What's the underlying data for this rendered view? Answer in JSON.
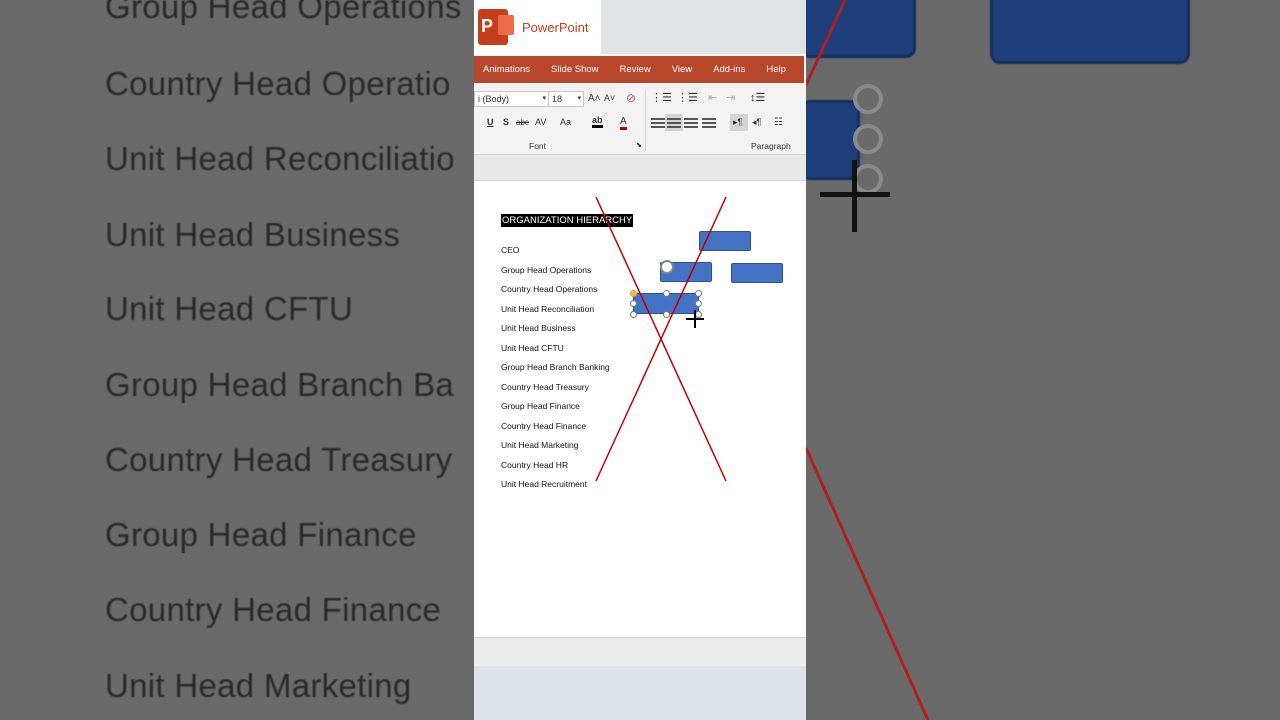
{
  "app": {
    "name": "PowerPoint",
    "logo_letter": "P"
  },
  "ribbon_tabs": [
    "Animations",
    "Slide Show",
    "Review",
    "View",
    "Add-ins",
    "Help"
  ],
  "font_group": {
    "font_name": "i (Body)",
    "font_size": "18",
    "label": "Font",
    "buttons": [
      "A˄",
      "A˅",
      "U",
      "S",
      "abc",
      "AV",
      "Aa",
      "A"
    ]
  },
  "paragraph_group": {
    "label": "Paragraph"
  },
  "slide": {
    "title": "ORGANIZATION HIERARCHY",
    "items": [
      "CEO",
      "Group Head Operations",
      "Country Head Operations",
      "Unit Head Reconciliation",
      "Unit Head Business",
      "Unit Head CFTU",
      "Group Head Branch Banking",
      "Country Head Treasury",
      "Group Head Finance",
      "Country Head Finance",
      "Unit Head Marketing",
      "Country Head HR",
      "Unit Head Recruitment"
    ]
  },
  "background_zoom_left": [
    "Group Head Operations",
    "Country Head Operatio",
    "Unit Head Reconciliatio",
    "Unit Head Business",
    "Unit Head CFTU",
    "Group Head Branch Ba",
    "Country Head Treasury",
    "Group Head Finance",
    "Country Head Finance",
    "Unit Head Marketing"
  ],
  "colors": {
    "accent": "#b7472a",
    "shape_fill": "#4472c4",
    "cross_line": "#c00000"
  }
}
